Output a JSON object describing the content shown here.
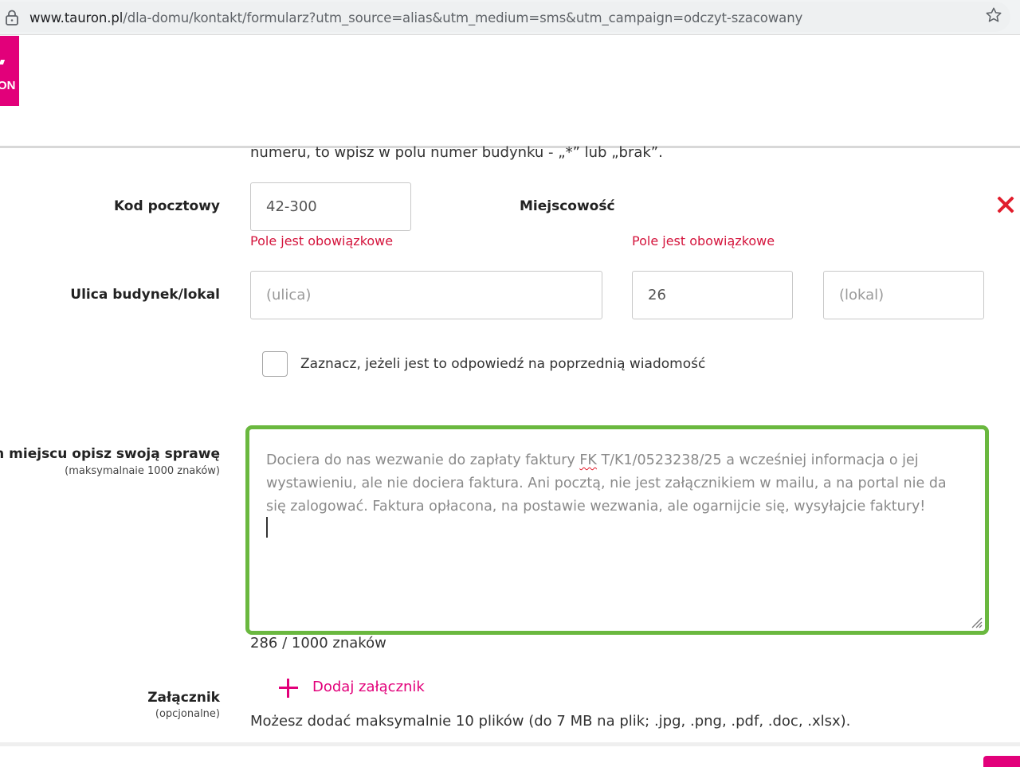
{
  "browser": {
    "url_host": "www.tauron.pl",
    "url_path": "/dla-domu/kontakt/formularz?utm_source=alias&utm_medium=sms&utm_campaign=odczyt-szacowany",
    "icons": [
      "lock-icon",
      "star-icon"
    ]
  },
  "header": {
    "logo_text": "ON",
    "brand_color": "#e2007a"
  },
  "form": {
    "note_text": "numeru, to wpisz w polu numer budynku - „*” lub „brak”.",
    "postal": {
      "label": "Kod pocztowy",
      "value": "42-300",
      "error": "Pole jest obowiązkowe"
    },
    "city": {
      "label": "Miejscowość",
      "error": "Pole jest obowiązkowe"
    },
    "street": {
      "label": "Ulica budynek/lokal",
      "street_placeholder": "(ulica)",
      "building_value": "26",
      "unit_placeholder": "(lokal)"
    },
    "reply_checkbox_label": "Zaznacz, jeżeli jest to odpowiedź na poprzednią wiadomość",
    "description": {
      "label": "W tym miejscu opisz swoją sprawę",
      "sublabel": "(maksymalnaie 1000 znaków)",
      "text_before": "Dociera do nas wezwanie do zapłaty faktury ",
      "text_misspelled": "FK",
      "text_after": " T/K1/0523238/25 a wcześniej informacja o jej wystawieniu, ale nie dociera faktura. Ani pocztą, nie jest załącznikiem w mailu, a na portal nie da się zalogować. Faktura opłacona, na postawie wezwania, ale ogarnijcie się, wysyłajcie faktury!",
      "counter": "286 / 1000 znaków",
      "border_color": "#6ab83f"
    },
    "attachment": {
      "label": "Załącznik",
      "sublabel": "(opcjonalne)",
      "add_label": "Dodaj załącznik",
      "info": "Możesz dodać maksymalnie 10 plików (do 7 MB na plik; .jpg, .png, .pdf, .doc, .xlsx)."
    },
    "error_color": "#d4143c"
  }
}
